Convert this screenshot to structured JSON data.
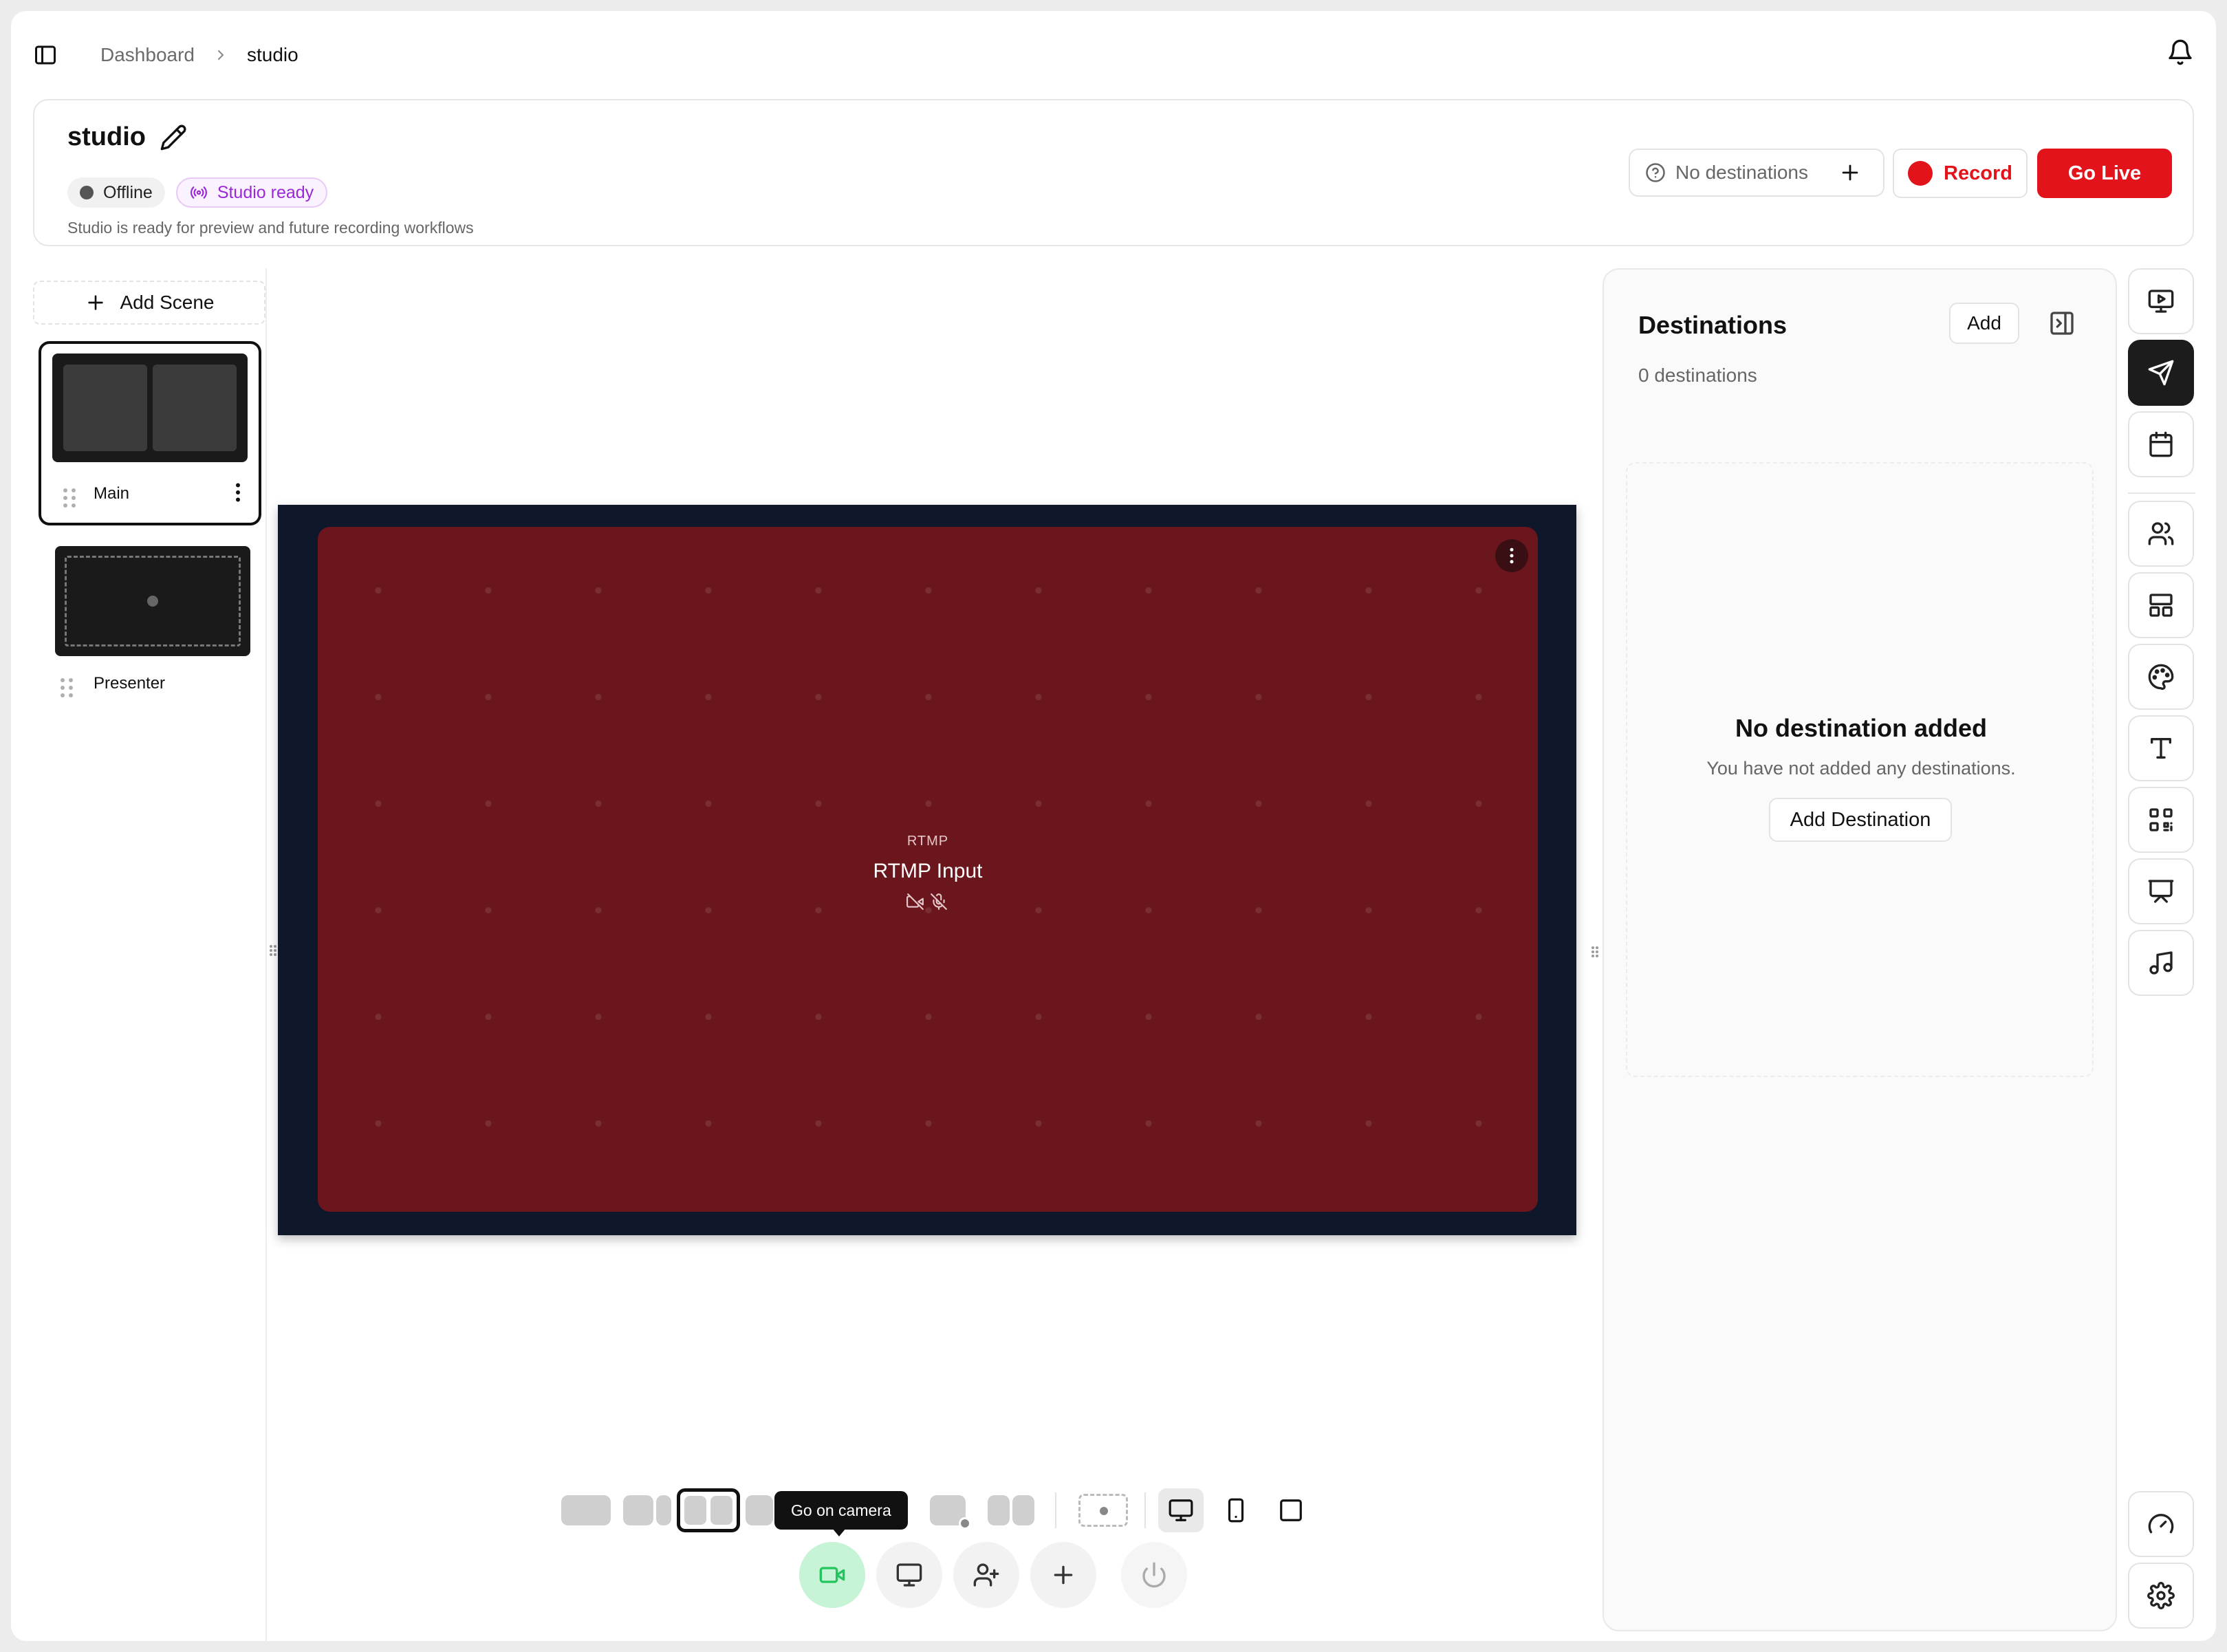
{
  "breadcrumb": {
    "items": [
      "Dashboard",
      "studio"
    ]
  },
  "header": {
    "title": "studio",
    "status_offline": "Offline",
    "status_ready": "Studio ready",
    "description": "Studio is ready for preview and future recording workflows",
    "no_destinations": "No destinations",
    "record_label": "Record",
    "golive_label": "Go Live"
  },
  "scenes": {
    "add_label": "Add Scene",
    "items": [
      {
        "label": "Main"
      },
      {
        "label": "Presenter"
      }
    ]
  },
  "preview": {
    "source_tag": "RTMP",
    "source_title": "RTMP Input"
  },
  "destinations": {
    "title": "Destinations",
    "add_label": "Add",
    "count_label": "0 destinations",
    "empty_title": "No destination added",
    "empty_text": "You have not added any destinations.",
    "add_destination_label": "Add Destination"
  },
  "controls": {
    "tooltip": "Go on camera"
  },
  "colors": {
    "accent_red": "#e3131b",
    "canvas_bg": "#0f172a",
    "source_bg": "#6b161d",
    "ready_purple": "#9b27d6",
    "camera_green": "#22c55e"
  },
  "icons": {
    "sidebar_toggle": "sidebar-toggle-icon",
    "bell": "bell-icon",
    "pencil": "pencil-icon",
    "help": "help-circle-icon",
    "plus": "plus-icon",
    "right_rail": [
      "monitor-play-icon",
      "send-icon",
      "calendar-icon",
      "users-icon",
      "layout-icon",
      "palette-icon",
      "text-icon",
      "qr-code-icon",
      "presentation-icon",
      "music-icon",
      "gauge-icon",
      "settings-icon"
    ]
  }
}
